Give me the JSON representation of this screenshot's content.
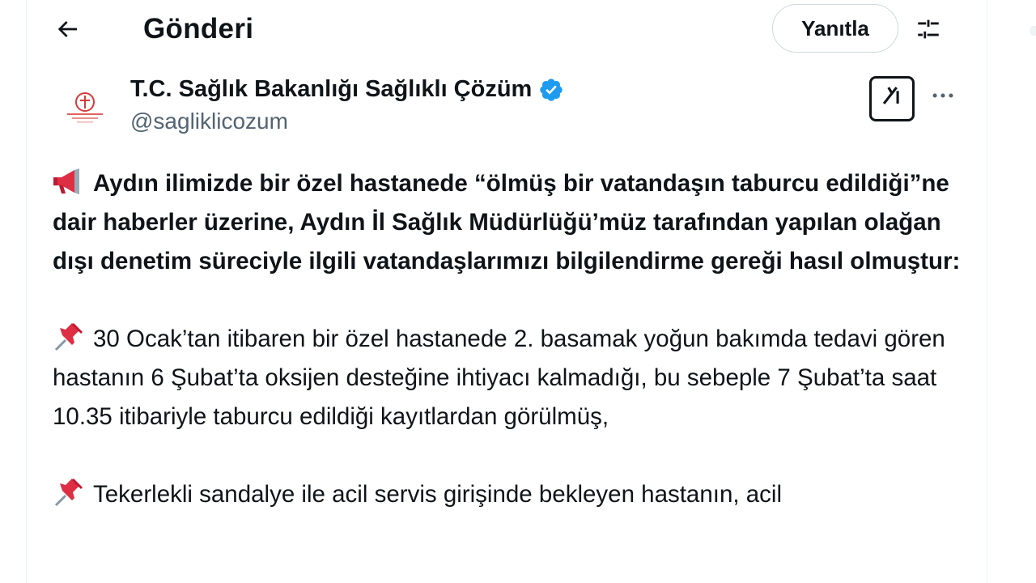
{
  "header": {
    "title": "Gönderi",
    "reply_label": "Yanıtla"
  },
  "author": {
    "name": "T.C. Sağlık Bakanlığı Sağlıklı Çözüm",
    "handle": "@sagliklicozum",
    "verified": true
  },
  "icons": {
    "back": "arrow-left-icon",
    "settings": "sliders-icon",
    "verified": "verified-badge-icon",
    "grok": "grok-icon",
    "more": "more-horizontal-icon",
    "megaphone": "megaphone-icon",
    "pushpin": "pushpin-icon"
  },
  "colors": {
    "verified_blue": "#1d9bf0",
    "text": "#0f1419",
    "secondary": "#536471"
  },
  "tweet": {
    "paragraph1": "Aydın ilimizde bir özel hastanede “ölmüş bir vatandaşın taburcu edildiği”ne dair haberler üzerine, Aydın İl Sağlık Müdürlüğü’müz tarafından yapılan olağan dışı denetim süreciyle ilgili vatandaşlarımızı bilgilendirme gereği hasıl olmuştur:",
    "paragraph2": "30 Ocak’tan itibaren bir özel hastanede 2. basamak yoğun bakımda tedavi gören hastanın 6 Şubat’ta oksijen desteğine ihtiyacı kalmadığı, bu sebeple 7 Şubat’ta saat 10.35 itibariyle taburcu edildiği kayıtlardan görülmüş,",
    "paragraph3": "Tekerlekli sandalye ile acil servis girişinde bekleyen hastanın, acil"
  }
}
